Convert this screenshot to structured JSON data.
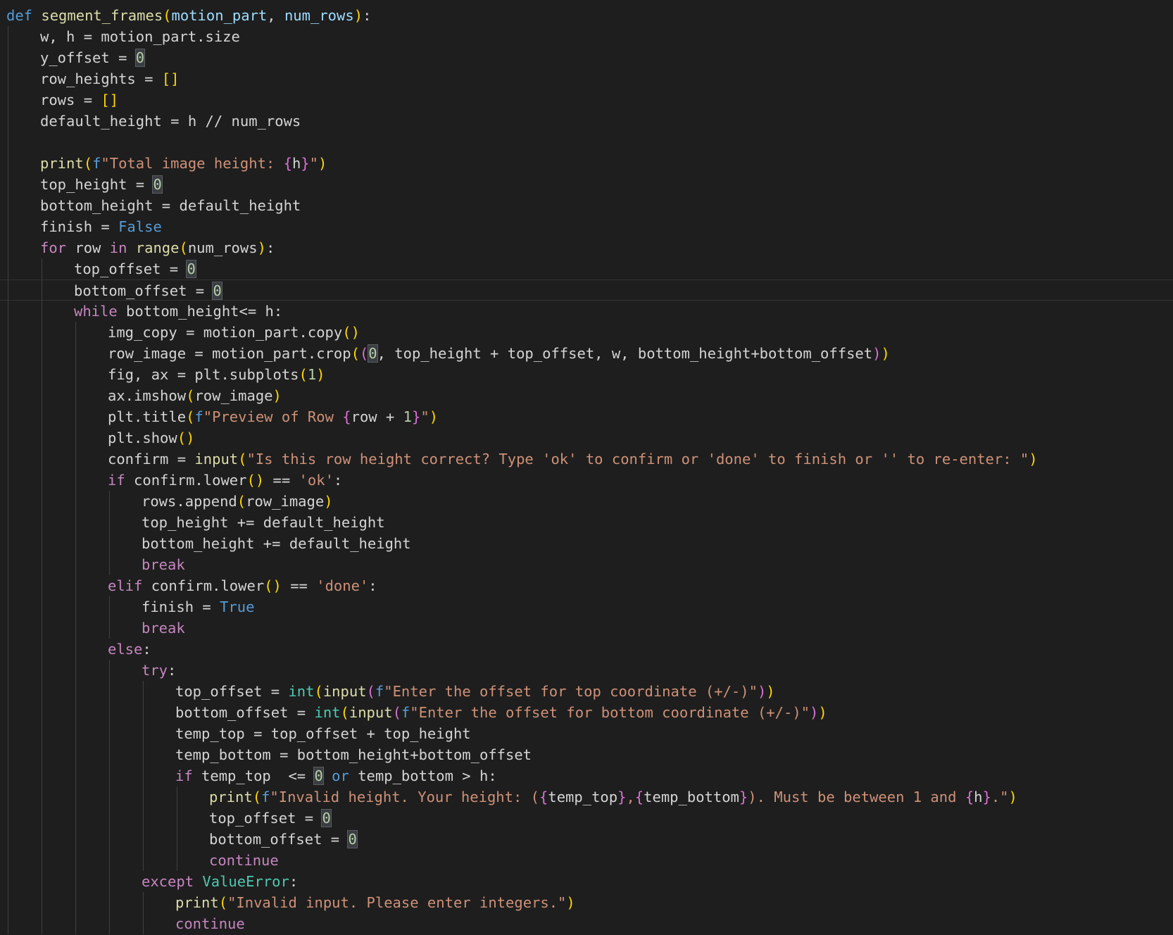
{
  "editor": {
    "language": "python",
    "cursor_line": 14,
    "lines": [
      {
        "indent": 0,
        "tokens": [
          [
            "def",
            "kw2"
          ],
          [
            " "
          ],
          [
            "segment_frames",
            "fn"
          ],
          [
            "(",
            "p1"
          ],
          [
            "motion_part",
            "param"
          ],
          [
            ", "
          ],
          [
            "num_rows",
            "param"
          ],
          [
            ")",
            "p1"
          ],
          [
            ":"
          ]
        ]
      },
      {
        "indent": 1,
        "tokens": [
          [
            "w, h = motion_part.size"
          ]
        ]
      },
      {
        "indent": 1,
        "tokens": [
          [
            "y_offset = "
          ],
          [
            "0",
            "num hl"
          ]
        ]
      },
      {
        "indent": 1,
        "tokens": [
          [
            "row_heights = "
          ],
          [
            "[]",
            "p1"
          ]
        ]
      },
      {
        "indent": 1,
        "tokens": [
          [
            "rows = "
          ],
          [
            "[]",
            "p1"
          ]
        ]
      },
      {
        "indent": 1,
        "tokens": [
          [
            "default_height = h // num_rows"
          ]
        ]
      },
      {
        "indent": 1,
        "tokens": []
      },
      {
        "indent": 1,
        "tokens": [
          [
            "print",
            "fn"
          ],
          [
            "(",
            "p1"
          ],
          [
            "f",
            "kw2"
          ],
          [
            "\"Total image height: ",
            "str"
          ],
          [
            "{",
            "p2"
          ],
          [
            "h"
          ],
          [
            "}",
            "p2"
          ],
          [
            "\"",
            "str"
          ],
          [
            ")",
            "p1"
          ]
        ]
      },
      {
        "indent": 1,
        "tokens": [
          [
            "top_height = "
          ],
          [
            "0",
            "num hl"
          ]
        ]
      },
      {
        "indent": 1,
        "tokens": [
          [
            "bottom_height = default_height"
          ]
        ]
      },
      {
        "indent": 1,
        "tokens": [
          [
            "finish = "
          ],
          [
            "False",
            "kw2"
          ]
        ]
      },
      {
        "indent": 1,
        "tokens": [
          [
            "for",
            "kw"
          ],
          [
            " row "
          ],
          [
            "in",
            "kw"
          ],
          [
            " "
          ],
          [
            "range",
            "fn"
          ],
          [
            "(",
            "p1"
          ],
          [
            "num_rows"
          ],
          [
            ")",
            "p1"
          ],
          [
            ":"
          ]
        ]
      },
      {
        "indent": 2,
        "tokens": [
          [
            "top_offset = "
          ],
          [
            "0",
            "num hl"
          ]
        ]
      },
      {
        "indent": 2,
        "tokens": [
          [
            "bottom_offset = "
          ],
          [
            "0",
            "num hl"
          ]
        ]
      },
      {
        "indent": 2,
        "tokens": [
          [
            "while",
            "kw"
          ],
          [
            " bottom_height<= h:"
          ]
        ]
      },
      {
        "indent": 3,
        "tokens": [
          [
            "img_copy = motion_part.copy"
          ],
          [
            "()",
            "p1"
          ]
        ]
      },
      {
        "indent": 3,
        "tokens": [
          [
            "row_image = motion_part.crop"
          ],
          [
            "(",
            "p1"
          ],
          [
            "(",
            "p2"
          ],
          [
            "0",
            "num hl"
          ],
          [
            ", top_height + top_offset, w, bottom_height+bottom_offset"
          ],
          [
            ")",
            "p2"
          ],
          [
            ")",
            "p1"
          ]
        ]
      },
      {
        "indent": 3,
        "tokens": [
          [
            "fig, ax = plt.subplots"
          ],
          [
            "(",
            "p1"
          ],
          [
            "1",
            "num"
          ],
          [
            ")",
            "p1"
          ]
        ]
      },
      {
        "indent": 3,
        "tokens": [
          [
            "ax.imshow"
          ],
          [
            "(",
            "p1"
          ],
          [
            "row_image"
          ],
          [
            ")",
            "p1"
          ]
        ]
      },
      {
        "indent": 3,
        "tokens": [
          [
            "plt.title"
          ],
          [
            "(",
            "p1"
          ],
          [
            "f",
            "kw2"
          ],
          [
            "\"Preview of Row ",
            "str"
          ],
          [
            "{",
            "p2"
          ],
          [
            "row + "
          ],
          [
            "1",
            "num"
          ],
          [
            "}",
            "p2"
          ],
          [
            "\"",
            "str"
          ],
          [
            ")",
            "p1"
          ]
        ]
      },
      {
        "indent": 3,
        "tokens": [
          [
            "plt.show"
          ],
          [
            "()",
            "p1"
          ]
        ]
      },
      {
        "indent": 3,
        "tokens": [
          [
            "confirm = "
          ],
          [
            "input",
            "fn"
          ],
          [
            "(",
            "p1"
          ],
          [
            "\"Is this row height correct? Type 'ok' to confirm or 'done' to finish or '' to re-enter: \"",
            "str"
          ],
          [
            ")",
            "p1"
          ]
        ]
      },
      {
        "indent": 3,
        "tokens": [
          [
            "if",
            "kw"
          ],
          [
            " confirm.lower"
          ],
          [
            "()",
            "p1"
          ],
          [
            " == "
          ],
          [
            "'ok'",
            "str"
          ],
          [
            ":"
          ]
        ]
      },
      {
        "indent": 4,
        "tokens": [
          [
            "rows.append"
          ],
          [
            "(",
            "p1"
          ],
          [
            "row_image"
          ],
          [
            ")",
            "p1"
          ]
        ]
      },
      {
        "indent": 4,
        "tokens": [
          [
            "top_height += default_height"
          ]
        ]
      },
      {
        "indent": 4,
        "tokens": [
          [
            "bottom_height += default_height"
          ]
        ]
      },
      {
        "indent": 4,
        "tokens": [
          [
            "break",
            "kw"
          ]
        ]
      },
      {
        "indent": 3,
        "tokens": [
          [
            "elif",
            "kw"
          ],
          [
            " confirm.lower"
          ],
          [
            "()",
            "p1"
          ],
          [
            " == "
          ],
          [
            "'done'",
            "str"
          ],
          [
            ":"
          ]
        ]
      },
      {
        "indent": 4,
        "tokens": [
          [
            "finish = "
          ],
          [
            "True",
            "kw2"
          ]
        ]
      },
      {
        "indent": 4,
        "tokens": [
          [
            "break",
            "kw"
          ]
        ]
      },
      {
        "indent": 3,
        "tokens": [
          [
            "else",
            "kw"
          ],
          [
            ":"
          ]
        ]
      },
      {
        "indent": 4,
        "tokens": [
          [
            "try",
            "kw"
          ],
          [
            ":"
          ]
        ]
      },
      {
        "indent": 5,
        "tokens": [
          [
            "top_offset = "
          ],
          [
            "int",
            "cls"
          ],
          [
            "(",
            "p1"
          ],
          [
            "input",
            "fn"
          ],
          [
            "(",
            "p2"
          ],
          [
            "f",
            "kw2"
          ],
          [
            "\"Enter the offset for top coordinate (+/-)\"",
            "str"
          ],
          [
            ")",
            "p2"
          ],
          [
            ")",
            "p1"
          ]
        ]
      },
      {
        "indent": 5,
        "tokens": [
          [
            "bottom_offset = "
          ],
          [
            "int",
            "cls"
          ],
          [
            "(",
            "p1"
          ],
          [
            "input",
            "fn"
          ],
          [
            "(",
            "p2"
          ],
          [
            "f",
            "kw2"
          ],
          [
            "\"Enter the offset for bottom coordinate (+/-)\"",
            "str"
          ],
          [
            ")",
            "p2"
          ],
          [
            ")",
            "p1"
          ]
        ]
      },
      {
        "indent": 5,
        "tokens": [
          [
            "temp_top = top_offset + top_height"
          ]
        ]
      },
      {
        "indent": 5,
        "tokens": [
          [
            "temp_bottom = bottom_height+bottom_offset"
          ]
        ]
      },
      {
        "indent": 5,
        "tokens": [
          [
            "if",
            "kw"
          ],
          [
            " temp_top  <= "
          ],
          [
            "0",
            "num hl"
          ],
          [
            " "
          ],
          [
            "or",
            "kw2"
          ],
          [
            " temp_bottom > h:"
          ]
        ]
      },
      {
        "indent": 6,
        "tokens": [
          [
            "print",
            "fn"
          ],
          [
            "(",
            "p1"
          ],
          [
            "f",
            "kw2"
          ],
          [
            "\"Invalid height. Your height: (",
            "str"
          ],
          [
            "{",
            "p2"
          ],
          [
            "temp_top"
          ],
          [
            "}",
            "p2"
          ],
          [
            ",",
            "str"
          ],
          [
            "{",
            "p2"
          ],
          [
            "temp_bottom"
          ],
          [
            "}",
            "p2"
          ],
          [
            "). Must be between 1 and ",
            "str"
          ],
          [
            "{",
            "p2"
          ],
          [
            "h"
          ],
          [
            "}",
            "p2"
          ],
          [
            ".\"",
            "str"
          ],
          [
            ")",
            "p1"
          ]
        ]
      },
      {
        "indent": 6,
        "tokens": [
          [
            "top_offset = "
          ],
          [
            "0",
            "num hl"
          ]
        ]
      },
      {
        "indent": 6,
        "tokens": [
          [
            "bottom_offset = "
          ],
          [
            "0",
            "num hl"
          ]
        ]
      },
      {
        "indent": 6,
        "tokens": [
          [
            "continue",
            "kw"
          ]
        ]
      },
      {
        "indent": 4,
        "tokens": [
          [
            "except",
            "kw"
          ],
          [
            " "
          ],
          [
            "ValueError",
            "cls"
          ],
          [
            ":"
          ]
        ]
      },
      {
        "indent": 5,
        "tokens": [
          [
            "print",
            "fn"
          ],
          [
            "(",
            "p1"
          ],
          [
            "\"Invalid input. Please enter integers.\"",
            "str"
          ],
          [
            ")",
            "p1"
          ]
        ]
      },
      {
        "indent": 5,
        "tokens": [
          [
            "continue",
            "kw"
          ]
        ]
      }
    ]
  }
}
